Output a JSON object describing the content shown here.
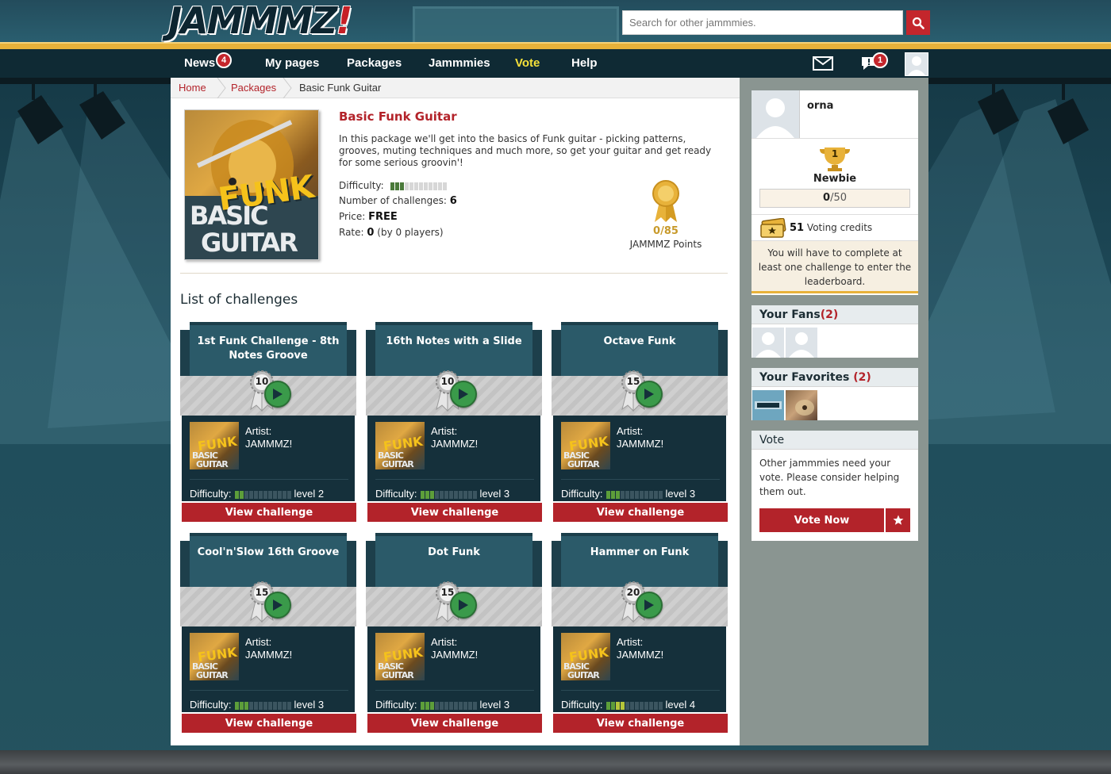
{
  "header": {
    "logo_text": "JAMMMZ",
    "logo_bang": "!",
    "search_placeholder": "Search for other jammmies."
  },
  "nav": {
    "items": [
      {
        "label": "News",
        "badge": "4"
      },
      {
        "label": "My pages"
      },
      {
        "label": "Packages"
      },
      {
        "label": "Jammmies"
      },
      {
        "label": "Vote",
        "active": true
      },
      {
        "label": "Help"
      }
    ],
    "messages_icon": "envelope-icon",
    "notifications_icon": "chat-bubble-icon",
    "notifications_badge": "1"
  },
  "breadcrumb": [
    "Home",
    "Packages",
    "Basic Funk Guitar"
  ],
  "package": {
    "cover": {
      "top": "FUNK",
      "basic": "BASIC",
      "guitar": "GUITAR"
    },
    "title": "Basic Funk Guitar",
    "description": "In this package we'll get into the basics of Funk guitar - picking patterns, grooves, muting techniques and much more, so get your guitar and get ready for some serious groovin'!",
    "difficulty_label": "Difficulty:",
    "difficulty_level": 3,
    "difficulty_max": 12,
    "challenges_label": "Number of challenges:",
    "challenges_count": "6",
    "price_label": "Price:",
    "price": "FREE",
    "rate_label": "Rate:",
    "rate_value": "0",
    "rate_suffix": "(by 0 players)",
    "points": "0/85",
    "points_label": "JAMMMZ Points"
  },
  "challenges_title": "List of challenges",
  "challenge_common": {
    "artist_label": "Artist:",
    "artist": "JAMMMZ!",
    "difficulty_label": "Difficulty:",
    "button": "View challenge",
    "thumb_funk": "FUNK",
    "thumb_basic": "BASIC",
    "thumb_guitar": "GUITAR"
  },
  "challenges": [
    {
      "title": "1st Funk Challenge - 8th Notes Groove",
      "points": "10",
      "level": "level 2",
      "level_num": 2
    },
    {
      "title": "16th Notes with a Slide",
      "points": "10",
      "level": "level 3",
      "level_num": 3
    },
    {
      "title": "Octave Funk",
      "points": "15",
      "level": "level 3",
      "level_num": 3
    },
    {
      "title": "Cool'n'Slow 16th Groove",
      "points": "15",
      "level": "level 3",
      "level_num": 3
    },
    {
      "title": "Dot Funk",
      "points": "15",
      "level": "level 3",
      "level_num": 3
    },
    {
      "title": "Hammer on Funk",
      "points": "20",
      "level": "level 4",
      "level_num": 4
    }
  ],
  "sidebar": {
    "profile_name": "orna",
    "rank_number": "1",
    "rank_title": "Newbie",
    "rank_progress_current": "0",
    "rank_progress_total": "/50",
    "voting_credits": "51",
    "voting_credits_label": "Voting credits",
    "leaderboard_note": "You will have to complete at least one challenge to enter the leaderboard.",
    "fans_label": "Your Fans",
    "fans_count": "(2)",
    "favorites_label": "Your Favorites",
    "favorites_count": "(2)",
    "vote_title": "Vote",
    "vote_text": "Other jammmies need your vote. Please consider helping them out.",
    "vote_button": "Vote Now"
  },
  "colors": {
    "accent_red": "#b3232a",
    "nav_bg": "#0f2a34",
    "active_nav": "#f5e13a",
    "header_stripe": "#e8b23a",
    "card_dark": "#15303b"
  }
}
